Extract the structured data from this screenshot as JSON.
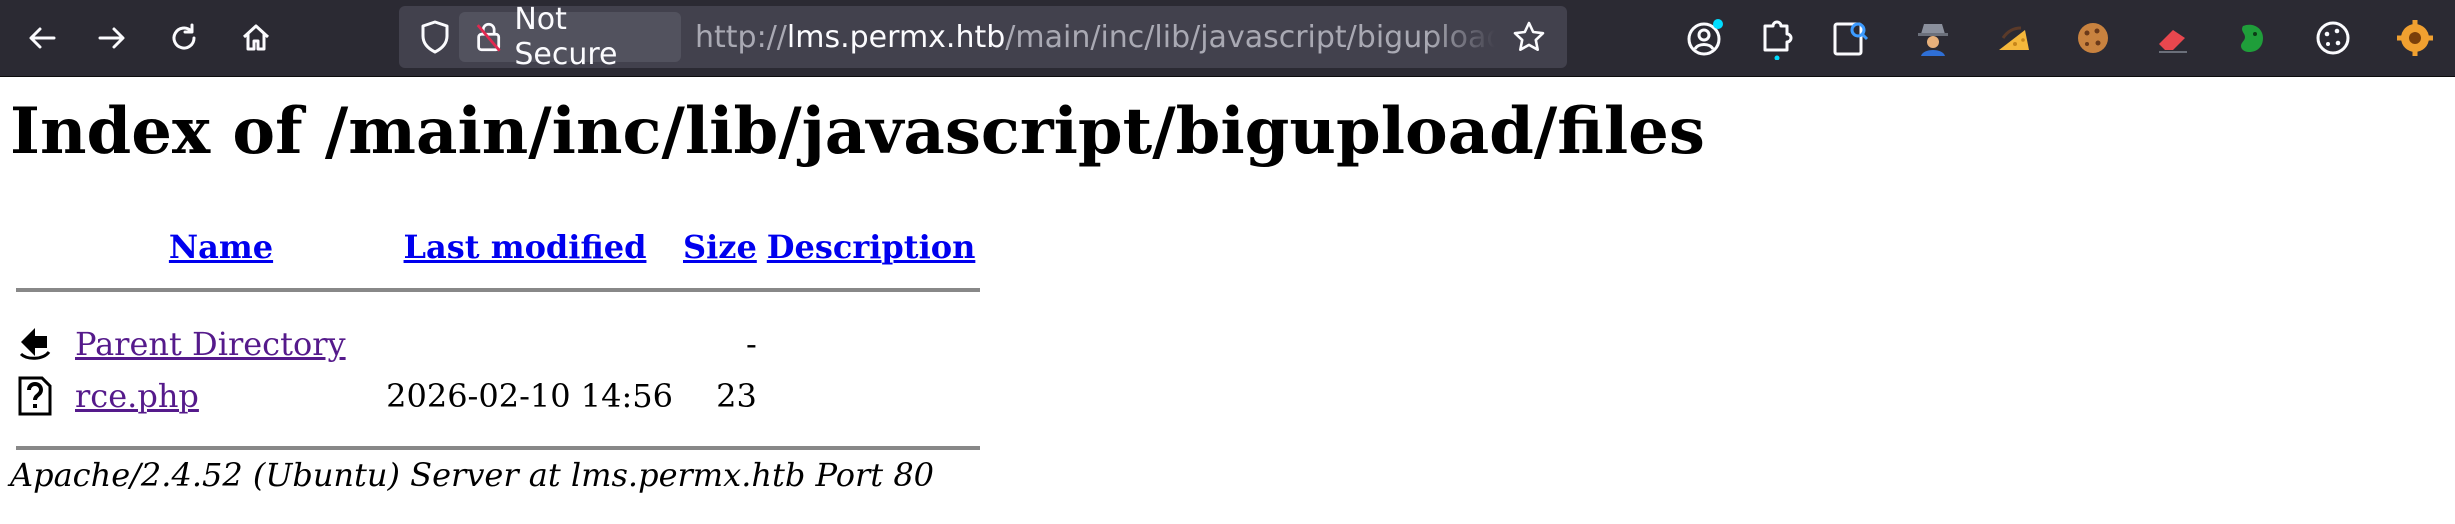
{
  "toolbar": {
    "security_label": "Not Secure",
    "url_scheme": "http://",
    "url_host": "lms.permx.htb",
    "url_path": "/main/inc/lib/javascript/bigupload/files"
  },
  "page": {
    "title": "Index of /main/inc/lib/javascript/bigupload/files",
    "columns": {
      "name": "Name",
      "last_modified": "Last modified",
      "size": "Size",
      "description": "Description"
    },
    "rows": [
      {
        "icon": "parent-directory-icon",
        "name": "Parent Directory",
        "last_modified": "",
        "size": "-",
        "description": ""
      },
      {
        "icon": "unknown-file-icon",
        "name": "rce.php",
        "last_modified": "2026-02-10 14:56",
        "size": "23",
        "description": ""
      }
    ],
    "server_address": "Apache/2.4.52 (Ubuntu) Server at lms.permx.htb Port 80"
  },
  "colors": {
    "toolbar_bg": "#2b2a33",
    "urlbar_bg": "#42414d",
    "link": "#0000ee",
    "visited_link": "#551a8b"
  }
}
